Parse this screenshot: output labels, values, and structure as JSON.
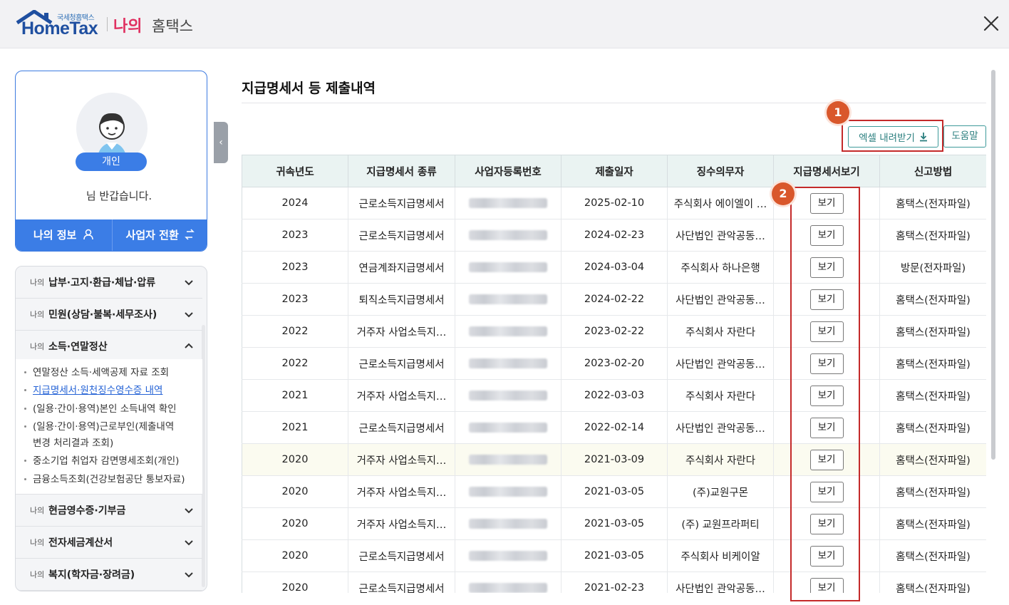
{
  "header": {
    "logo_small": "국세청홈택스",
    "logo_main": "HomeTax",
    "logo_my": "나의",
    "logo_hometax": "홈택스"
  },
  "profile": {
    "badge": "개인",
    "greeting": "님 반갑습니다.",
    "my_info": "나의 정보",
    "switch_business": "사업자 전환"
  },
  "menu": {
    "prefix": "나의",
    "items": [
      {
        "title": "납부·고지·환급·체납·압류",
        "expanded": false
      },
      {
        "title": "민원(상담·불복·세무조사)",
        "expanded": false
      },
      {
        "title": "소득·연말정산",
        "expanded": true
      },
      {
        "title": "현금영수증·기부금",
        "expanded": false
      },
      {
        "title": "전자세금계산서",
        "expanded": false
      },
      {
        "title": "복지(학자금·장려금)",
        "expanded": false
      }
    ],
    "subitems": [
      "연말정산 소득·세액공제 자료 조회",
      "지급명세서·원천징수영수증 내역",
      "(일용·간이·용역)본인 소득내역 확인",
      "(일용·간이·용역)근로부인(제출내역",
      "변경 처리결과 조회)",
      "중소기업 취업자 감면명세조회(개인)",
      "금융소득조회(건강보험공단 통보자료)"
    ]
  },
  "main": {
    "title": "지급명세서 등 제출내역",
    "excel_button": "엑셀 내려받기",
    "help_button": "도움말",
    "annotations": [
      "1",
      "2"
    ],
    "columns": [
      "귀속년도",
      "지급명세서 종류",
      "사업자등록번호",
      "제출일자",
      "징수의무자",
      "지급명세서보기",
      "신고방법"
    ],
    "view_label": "보기",
    "rows": [
      {
        "year": "2024",
        "type": "근로소득지급명세서",
        "date": "2025-02-10",
        "payer": "주식회사 에이엘이 …",
        "method": "홈택스(전자파일)"
      },
      {
        "year": "2023",
        "type": "근로소득지급명세서",
        "date": "2024-02-23",
        "payer": "사단법인 관악공동…",
        "method": "홈택스(전자파일)"
      },
      {
        "year": "2023",
        "type": "연금계좌지급명세서",
        "date": "2024-03-04",
        "payer": "주식회사 하나은행",
        "method": "방문(전자파일)"
      },
      {
        "year": "2023",
        "type": "퇴직소득지급명세서",
        "date": "2024-02-22",
        "payer": "사단법인 관악공동…",
        "method": "홈택스(전자파일)"
      },
      {
        "year": "2022",
        "type": "거주자 사업소득지…",
        "date": "2023-02-22",
        "payer": "주식회사 자란다",
        "method": "홈택스(전자파일)"
      },
      {
        "year": "2022",
        "type": "근로소득지급명세서",
        "date": "2023-02-20",
        "payer": "사단법인 관악공동…",
        "method": "홈택스(전자파일)"
      },
      {
        "year": "2021",
        "type": "거주자 사업소득지…",
        "date": "2022-03-03",
        "payer": "주식회사 자란다",
        "method": "홈택스(전자파일)"
      },
      {
        "year": "2021",
        "type": "근로소득지급명세서",
        "date": "2022-02-14",
        "payer": "사단법인 관악공동…",
        "method": "홈택스(전자파일)"
      },
      {
        "year": "2020",
        "type": "거주자 사업소득지…",
        "date": "2021-03-09",
        "payer": "주식회사 자란다",
        "method": "홈택스(전자파일)"
      },
      {
        "year": "2020",
        "type": "거주자 사업소득지…",
        "date": "2021-03-05",
        "payer": "(주)교원구몬",
        "method": "홈택스(전자파일)"
      },
      {
        "year": "2020",
        "type": "거주자 사업소득지…",
        "date": "2021-03-05",
        "payer": "(주) 교원프라퍼티",
        "method": "홈택스(전자파일)"
      },
      {
        "year": "2020",
        "type": "근로소득지급명세서",
        "date": "2021-03-05",
        "payer": "주식회사 비케이알",
        "method": "홈택스(전자파일)"
      },
      {
        "year": "2020",
        "type": "근로소득지급명세서",
        "date": "2021-02-23",
        "payer": "사단법인 관악공동…",
        "method": "홈택스(전자파일)"
      }
    ],
    "highlighted_row": 8
  },
  "colors": {
    "accent_blue": "#3b7de6",
    "teal": "#2b7f7f",
    "annotation_red": "#c42a2a",
    "annotation_orange": "#d9572b"
  }
}
